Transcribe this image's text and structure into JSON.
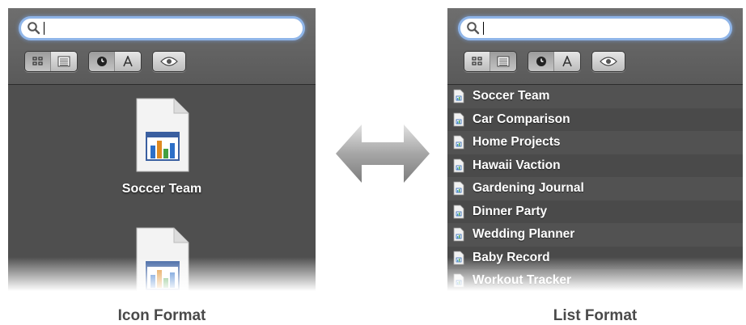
{
  "search": {
    "value": "",
    "placeholder": ""
  },
  "toolbar": {
    "view_buttons": [
      "grid-view",
      "list-view"
    ],
    "sort_buttons": [
      "sort-by-date",
      "sort-by-name"
    ],
    "preview_button": "quick-look"
  },
  "icon_view": {
    "items": [
      {
        "label": "Soccer Team"
      },
      {
        "label": ""
      }
    ]
  },
  "list_view": {
    "items": [
      "Soccer Team",
      "Car Comparison",
      "Home Projects",
      "Hawaii Vaction",
      "Gardening Journal",
      "Dinner Party",
      "Wedding Planner",
      "Baby Record",
      "Workout Tracker"
    ]
  },
  "captions": {
    "left": "Icon Format",
    "right": "List Format"
  },
  "colors": {
    "panel_bg": "#4f4f4f",
    "toolbar_bg": "#646464",
    "search_glow": "#8fb5e8",
    "caption_text": "#4a4a4a"
  }
}
